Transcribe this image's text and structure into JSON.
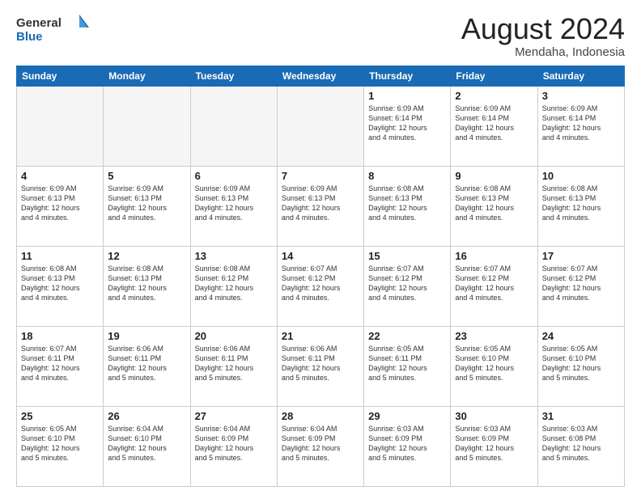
{
  "header": {
    "logo_general": "General",
    "logo_blue": "Blue",
    "month_title": "August 2024",
    "location": "Mendaha, Indonesia"
  },
  "weekdays": [
    "Sunday",
    "Monday",
    "Tuesday",
    "Wednesday",
    "Thursday",
    "Friday",
    "Saturday"
  ],
  "weeks": [
    [
      {
        "day": "",
        "empty": true
      },
      {
        "day": "",
        "empty": true
      },
      {
        "day": "",
        "empty": true
      },
      {
        "day": "",
        "empty": true
      },
      {
        "day": "1",
        "lines": [
          "Sunrise: 6:09 AM",
          "Sunset: 6:14 PM",
          "Daylight: 12 hours",
          "and 4 minutes."
        ]
      },
      {
        "day": "2",
        "lines": [
          "Sunrise: 6:09 AM",
          "Sunset: 6:14 PM",
          "Daylight: 12 hours",
          "and 4 minutes."
        ]
      },
      {
        "day": "3",
        "lines": [
          "Sunrise: 6:09 AM",
          "Sunset: 6:14 PM",
          "Daylight: 12 hours",
          "and 4 minutes."
        ]
      }
    ],
    [
      {
        "day": "4",
        "lines": [
          "Sunrise: 6:09 AM",
          "Sunset: 6:13 PM",
          "Daylight: 12 hours",
          "and 4 minutes."
        ]
      },
      {
        "day": "5",
        "lines": [
          "Sunrise: 6:09 AM",
          "Sunset: 6:13 PM",
          "Daylight: 12 hours",
          "and 4 minutes."
        ]
      },
      {
        "day": "6",
        "lines": [
          "Sunrise: 6:09 AM",
          "Sunset: 6:13 PM",
          "Daylight: 12 hours",
          "and 4 minutes."
        ]
      },
      {
        "day": "7",
        "lines": [
          "Sunrise: 6:09 AM",
          "Sunset: 6:13 PM",
          "Daylight: 12 hours",
          "and 4 minutes."
        ]
      },
      {
        "day": "8",
        "lines": [
          "Sunrise: 6:08 AM",
          "Sunset: 6:13 PM",
          "Daylight: 12 hours",
          "and 4 minutes."
        ]
      },
      {
        "day": "9",
        "lines": [
          "Sunrise: 6:08 AM",
          "Sunset: 6:13 PM",
          "Daylight: 12 hours",
          "and 4 minutes."
        ]
      },
      {
        "day": "10",
        "lines": [
          "Sunrise: 6:08 AM",
          "Sunset: 6:13 PM",
          "Daylight: 12 hours",
          "and 4 minutes."
        ]
      }
    ],
    [
      {
        "day": "11",
        "lines": [
          "Sunrise: 6:08 AM",
          "Sunset: 6:13 PM",
          "Daylight: 12 hours",
          "and 4 minutes."
        ]
      },
      {
        "day": "12",
        "lines": [
          "Sunrise: 6:08 AM",
          "Sunset: 6:13 PM",
          "Daylight: 12 hours",
          "and 4 minutes."
        ]
      },
      {
        "day": "13",
        "lines": [
          "Sunrise: 6:08 AM",
          "Sunset: 6:12 PM",
          "Daylight: 12 hours",
          "and 4 minutes."
        ]
      },
      {
        "day": "14",
        "lines": [
          "Sunrise: 6:07 AM",
          "Sunset: 6:12 PM",
          "Daylight: 12 hours",
          "and 4 minutes."
        ]
      },
      {
        "day": "15",
        "lines": [
          "Sunrise: 6:07 AM",
          "Sunset: 6:12 PM",
          "Daylight: 12 hours",
          "and 4 minutes."
        ]
      },
      {
        "day": "16",
        "lines": [
          "Sunrise: 6:07 AM",
          "Sunset: 6:12 PM",
          "Daylight: 12 hours",
          "and 4 minutes."
        ]
      },
      {
        "day": "17",
        "lines": [
          "Sunrise: 6:07 AM",
          "Sunset: 6:12 PM",
          "Daylight: 12 hours",
          "and 4 minutes."
        ]
      }
    ],
    [
      {
        "day": "18",
        "lines": [
          "Sunrise: 6:07 AM",
          "Sunset: 6:11 PM",
          "Daylight: 12 hours",
          "and 4 minutes."
        ]
      },
      {
        "day": "19",
        "lines": [
          "Sunrise: 6:06 AM",
          "Sunset: 6:11 PM",
          "Daylight: 12 hours",
          "and 5 minutes."
        ]
      },
      {
        "day": "20",
        "lines": [
          "Sunrise: 6:06 AM",
          "Sunset: 6:11 PM",
          "Daylight: 12 hours",
          "and 5 minutes."
        ]
      },
      {
        "day": "21",
        "lines": [
          "Sunrise: 6:06 AM",
          "Sunset: 6:11 PM",
          "Daylight: 12 hours",
          "and 5 minutes."
        ]
      },
      {
        "day": "22",
        "lines": [
          "Sunrise: 6:05 AM",
          "Sunset: 6:11 PM",
          "Daylight: 12 hours",
          "and 5 minutes."
        ]
      },
      {
        "day": "23",
        "lines": [
          "Sunrise: 6:05 AM",
          "Sunset: 6:10 PM",
          "Daylight: 12 hours",
          "and 5 minutes."
        ]
      },
      {
        "day": "24",
        "lines": [
          "Sunrise: 6:05 AM",
          "Sunset: 6:10 PM",
          "Daylight: 12 hours",
          "and 5 minutes."
        ]
      }
    ],
    [
      {
        "day": "25",
        "lines": [
          "Sunrise: 6:05 AM",
          "Sunset: 6:10 PM",
          "Daylight: 12 hours",
          "and 5 minutes."
        ]
      },
      {
        "day": "26",
        "lines": [
          "Sunrise: 6:04 AM",
          "Sunset: 6:10 PM",
          "Daylight: 12 hours",
          "and 5 minutes."
        ]
      },
      {
        "day": "27",
        "lines": [
          "Sunrise: 6:04 AM",
          "Sunset: 6:09 PM",
          "Daylight: 12 hours",
          "and 5 minutes."
        ]
      },
      {
        "day": "28",
        "lines": [
          "Sunrise: 6:04 AM",
          "Sunset: 6:09 PM",
          "Daylight: 12 hours",
          "and 5 minutes."
        ]
      },
      {
        "day": "29",
        "lines": [
          "Sunrise: 6:03 AM",
          "Sunset: 6:09 PM",
          "Daylight: 12 hours",
          "and 5 minutes."
        ]
      },
      {
        "day": "30",
        "lines": [
          "Sunrise: 6:03 AM",
          "Sunset: 6:09 PM",
          "Daylight: 12 hours",
          "and 5 minutes."
        ]
      },
      {
        "day": "31",
        "lines": [
          "Sunrise: 6:03 AM",
          "Sunset: 6:08 PM",
          "Daylight: 12 hours",
          "and 5 minutes."
        ]
      }
    ]
  ]
}
